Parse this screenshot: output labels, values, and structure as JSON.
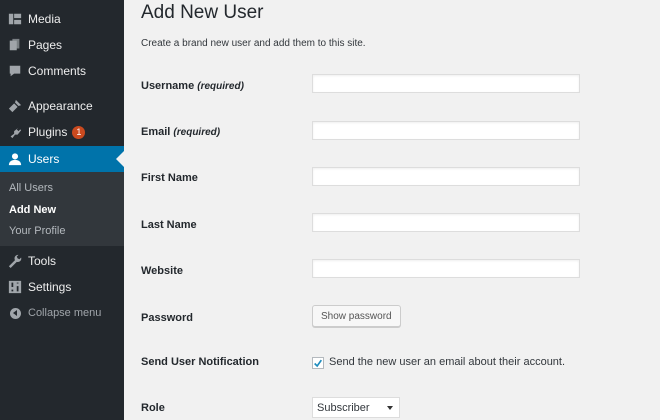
{
  "sidebar": {
    "items": [
      {
        "label": "Media",
        "icon": "media-icon"
      },
      {
        "label": "Pages",
        "icon": "pages-icon"
      },
      {
        "label": "Comments",
        "icon": "comments-icon"
      },
      {
        "label": "Appearance",
        "icon": "appearance-icon"
      },
      {
        "label": "Plugins",
        "icon": "plugins-icon",
        "badge": "1"
      },
      {
        "label": "Users",
        "icon": "users-icon"
      },
      {
        "label": "Tools",
        "icon": "tools-icon"
      },
      {
        "label": "Settings",
        "icon": "settings-icon"
      }
    ],
    "submenu": [
      "All Users",
      "Add New",
      "Your Profile"
    ],
    "collapse": "Collapse menu",
    "active_color": "#0073aa",
    "badge_color": "#ca4a1f"
  },
  "page": {
    "title": "Add New User",
    "description": "Create a brand new user and add them to this site."
  },
  "form": {
    "username_label": "Username",
    "username_required": "(required)",
    "email_label": "Email",
    "email_required": "(required)",
    "first_name_label": "First Name",
    "last_name_label": "Last Name",
    "website_label": "Website",
    "password_label": "Password",
    "show_password": "Show password",
    "notification_label": "Send User Notification",
    "notification_text": "Send the new user an email about their account.",
    "notification_checked": true,
    "role_label": "Role",
    "role_value": "Subscriber"
  }
}
